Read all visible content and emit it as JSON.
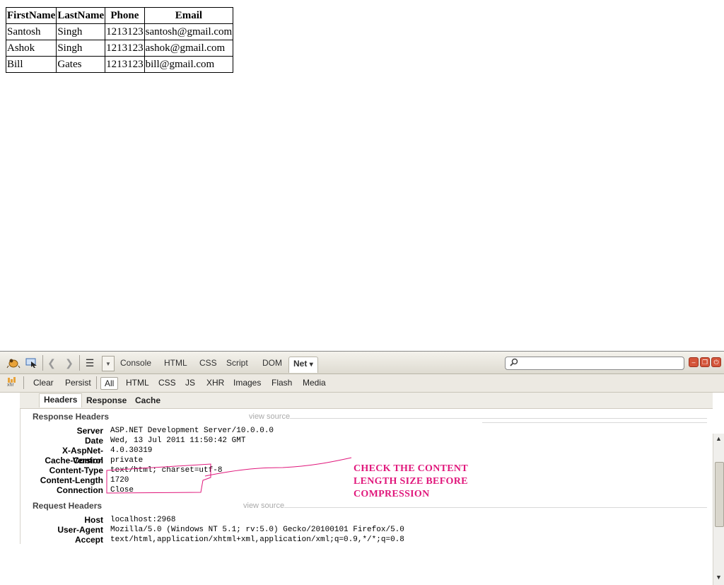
{
  "people_table": {
    "headers": [
      "FirstName",
      "LastName",
      "Phone",
      "Email"
    ],
    "rows": [
      [
        "Santosh",
        "Singh",
        "1213123",
        "santosh@gmail.com"
      ],
      [
        "Ashok",
        "Singh",
        "1213123",
        "ashok@gmail.com"
      ],
      [
        "Bill",
        "Gates",
        "1213123",
        "bill@gmail.com"
      ]
    ]
  },
  "firebug": {
    "main_tabs": [
      "Console",
      "HTML",
      "CSS",
      "Script",
      "DOM",
      "Net"
    ],
    "active_main_tab": "Net",
    "net_dropdown_caret": "▾",
    "sub_toolbar": {
      "clear_label": "Clear",
      "persist_label": "Persist",
      "filters": [
        "All",
        "HTML",
        "CSS",
        "JS",
        "XHR",
        "Images",
        "Flash",
        "Media"
      ],
      "active_filter": "All",
      "xhr_icon_label": "xhr"
    },
    "detail_tabs": [
      "Headers",
      "Response",
      "Cache"
    ],
    "active_detail_tab": "Headers",
    "response_headers": {
      "title": "Response Headers",
      "view_source": "view source",
      "items": [
        {
          "name": "Server",
          "value": "ASP.NET Development Server/10.0.0.0"
        },
        {
          "name": "Date",
          "value": "Wed, 13 Jul 2011 11:50:42 GMT"
        },
        {
          "name": "X-AspNet-Version",
          "value": "4.0.30319"
        },
        {
          "name": "Cache-Control",
          "value": "private"
        },
        {
          "name": "Content-Type",
          "value": "text/html; charset=utf-8"
        },
        {
          "name": "Content-Length",
          "value": "1720"
        },
        {
          "name": "Connection",
          "value": "Close"
        }
      ]
    },
    "request_headers": {
      "title": "Request Headers",
      "view_source": "view source",
      "items": [
        {
          "name": "Host",
          "value": "localhost:2968"
        },
        {
          "name": "User-Agent",
          "value": "Mozilla/5.0 (Windows NT 5.1; rv:5.0) Gecko/20100101 Firefox/5.0"
        },
        {
          "name": "Accept",
          "value": "text/html,application/xhtml+xml,application/xml;q=0.9,*/*;q=0.8"
        }
      ]
    },
    "annotation": {
      "lines": [
        "CHECK THE CONTENT",
        "LENGTH SIZE BEFORE",
        "COMPRESSION"
      ],
      "color": "#e0177b"
    }
  }
}
